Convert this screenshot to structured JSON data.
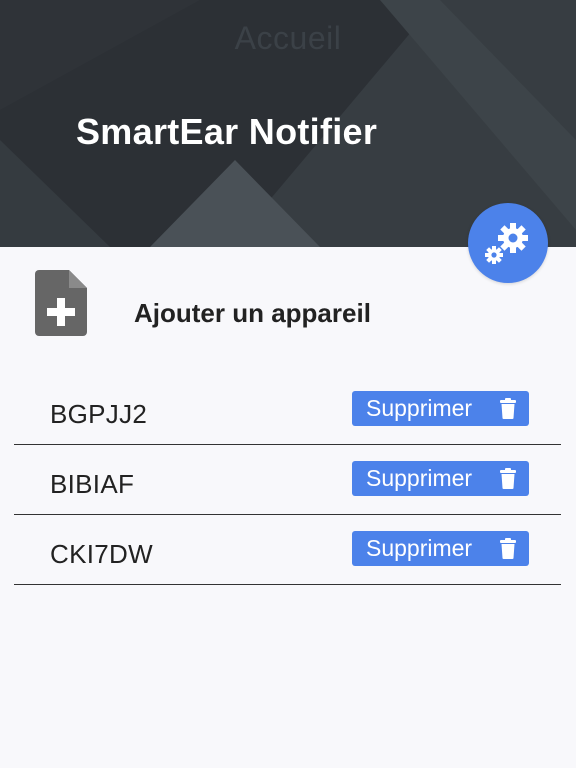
{
  "header": {
    "nav_title": "Accueil",
    "app_title": "SmartEar Notifier",
    "background_color": "#2c3035"
  },
  "settings_button": {
    "icon": "gears-icon",
    "color": "#4c82ea"
  },
  "add_device": {
    "icon": "file-add-icon",
    "label": "Ajouter un appareil"
  },
  "devices": [
    {
      "name": "BGPJJ2",
      "delete_label": "Supprimer"
    },
    {
      "name": "BIBIAF",
      "delete_label": "Supprimer"
    },
    {
      "name": "CKI7DW",
      "delete_label": "Supprimer"
    }
  ],
  "colors": {
    "accent": "#4c82ea",
    "background": "#f8f8fb",
    "text": "#222222"
  }
}
